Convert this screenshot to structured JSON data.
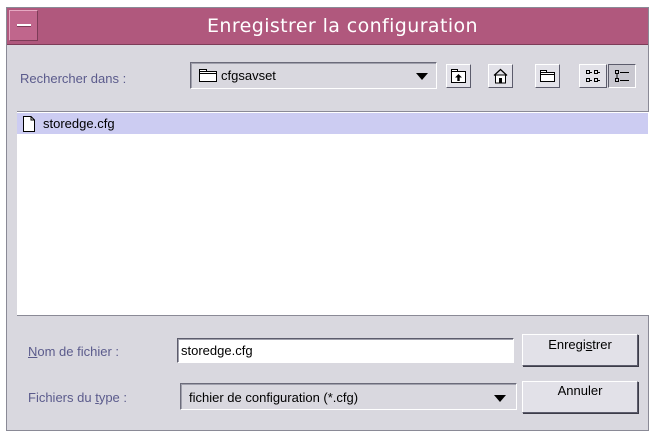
{
  "window": {
    "title": "Enregistrer la configuration"
  },
  "toolbar": {
    "look_in_label": "Rechercher dans :",
    "look_in_value": "cfgsavset",
    "buttons": [
      {
        "name": "up-one-level-icon"
      },
      {
        "name": "home-icon"
      },
      {
        "name": "new-folder-icon"
      },
      {
        "name": "list-view-icon"
      },
      {
        "name": "details-view-icon",
        "active": true
      }
    ]
  },
  "file_list": {
    "items": [
      {
        "name": "storedge.cfg",
        "selected": true
      }
    ]
  },
  "file_name": {
    "label_mnemonic": "N",
    "label_rest": "om de fichier :",
    "value": "storedge.cfg"
  },
  "file_type": {
    "label_pre": "Fichiers du ",
    "label_mnemonic": "t",
    "label_post": "ype :",
    "value": "fichier de configuration (*.cfg)"
  },
  "buttons": {
    "save_pre": "Enregi",
    "save_mnemonic": "s",
    "save_post": "trer",
    "cancel": "Annuler"
  },
  "colors": {
    "titlebar": "#b0587d",
    "selection": "#ccccf2",
    "label_text": "#5b5b8c",
    "dialog_bg": "#d9d8df"
  }
}
